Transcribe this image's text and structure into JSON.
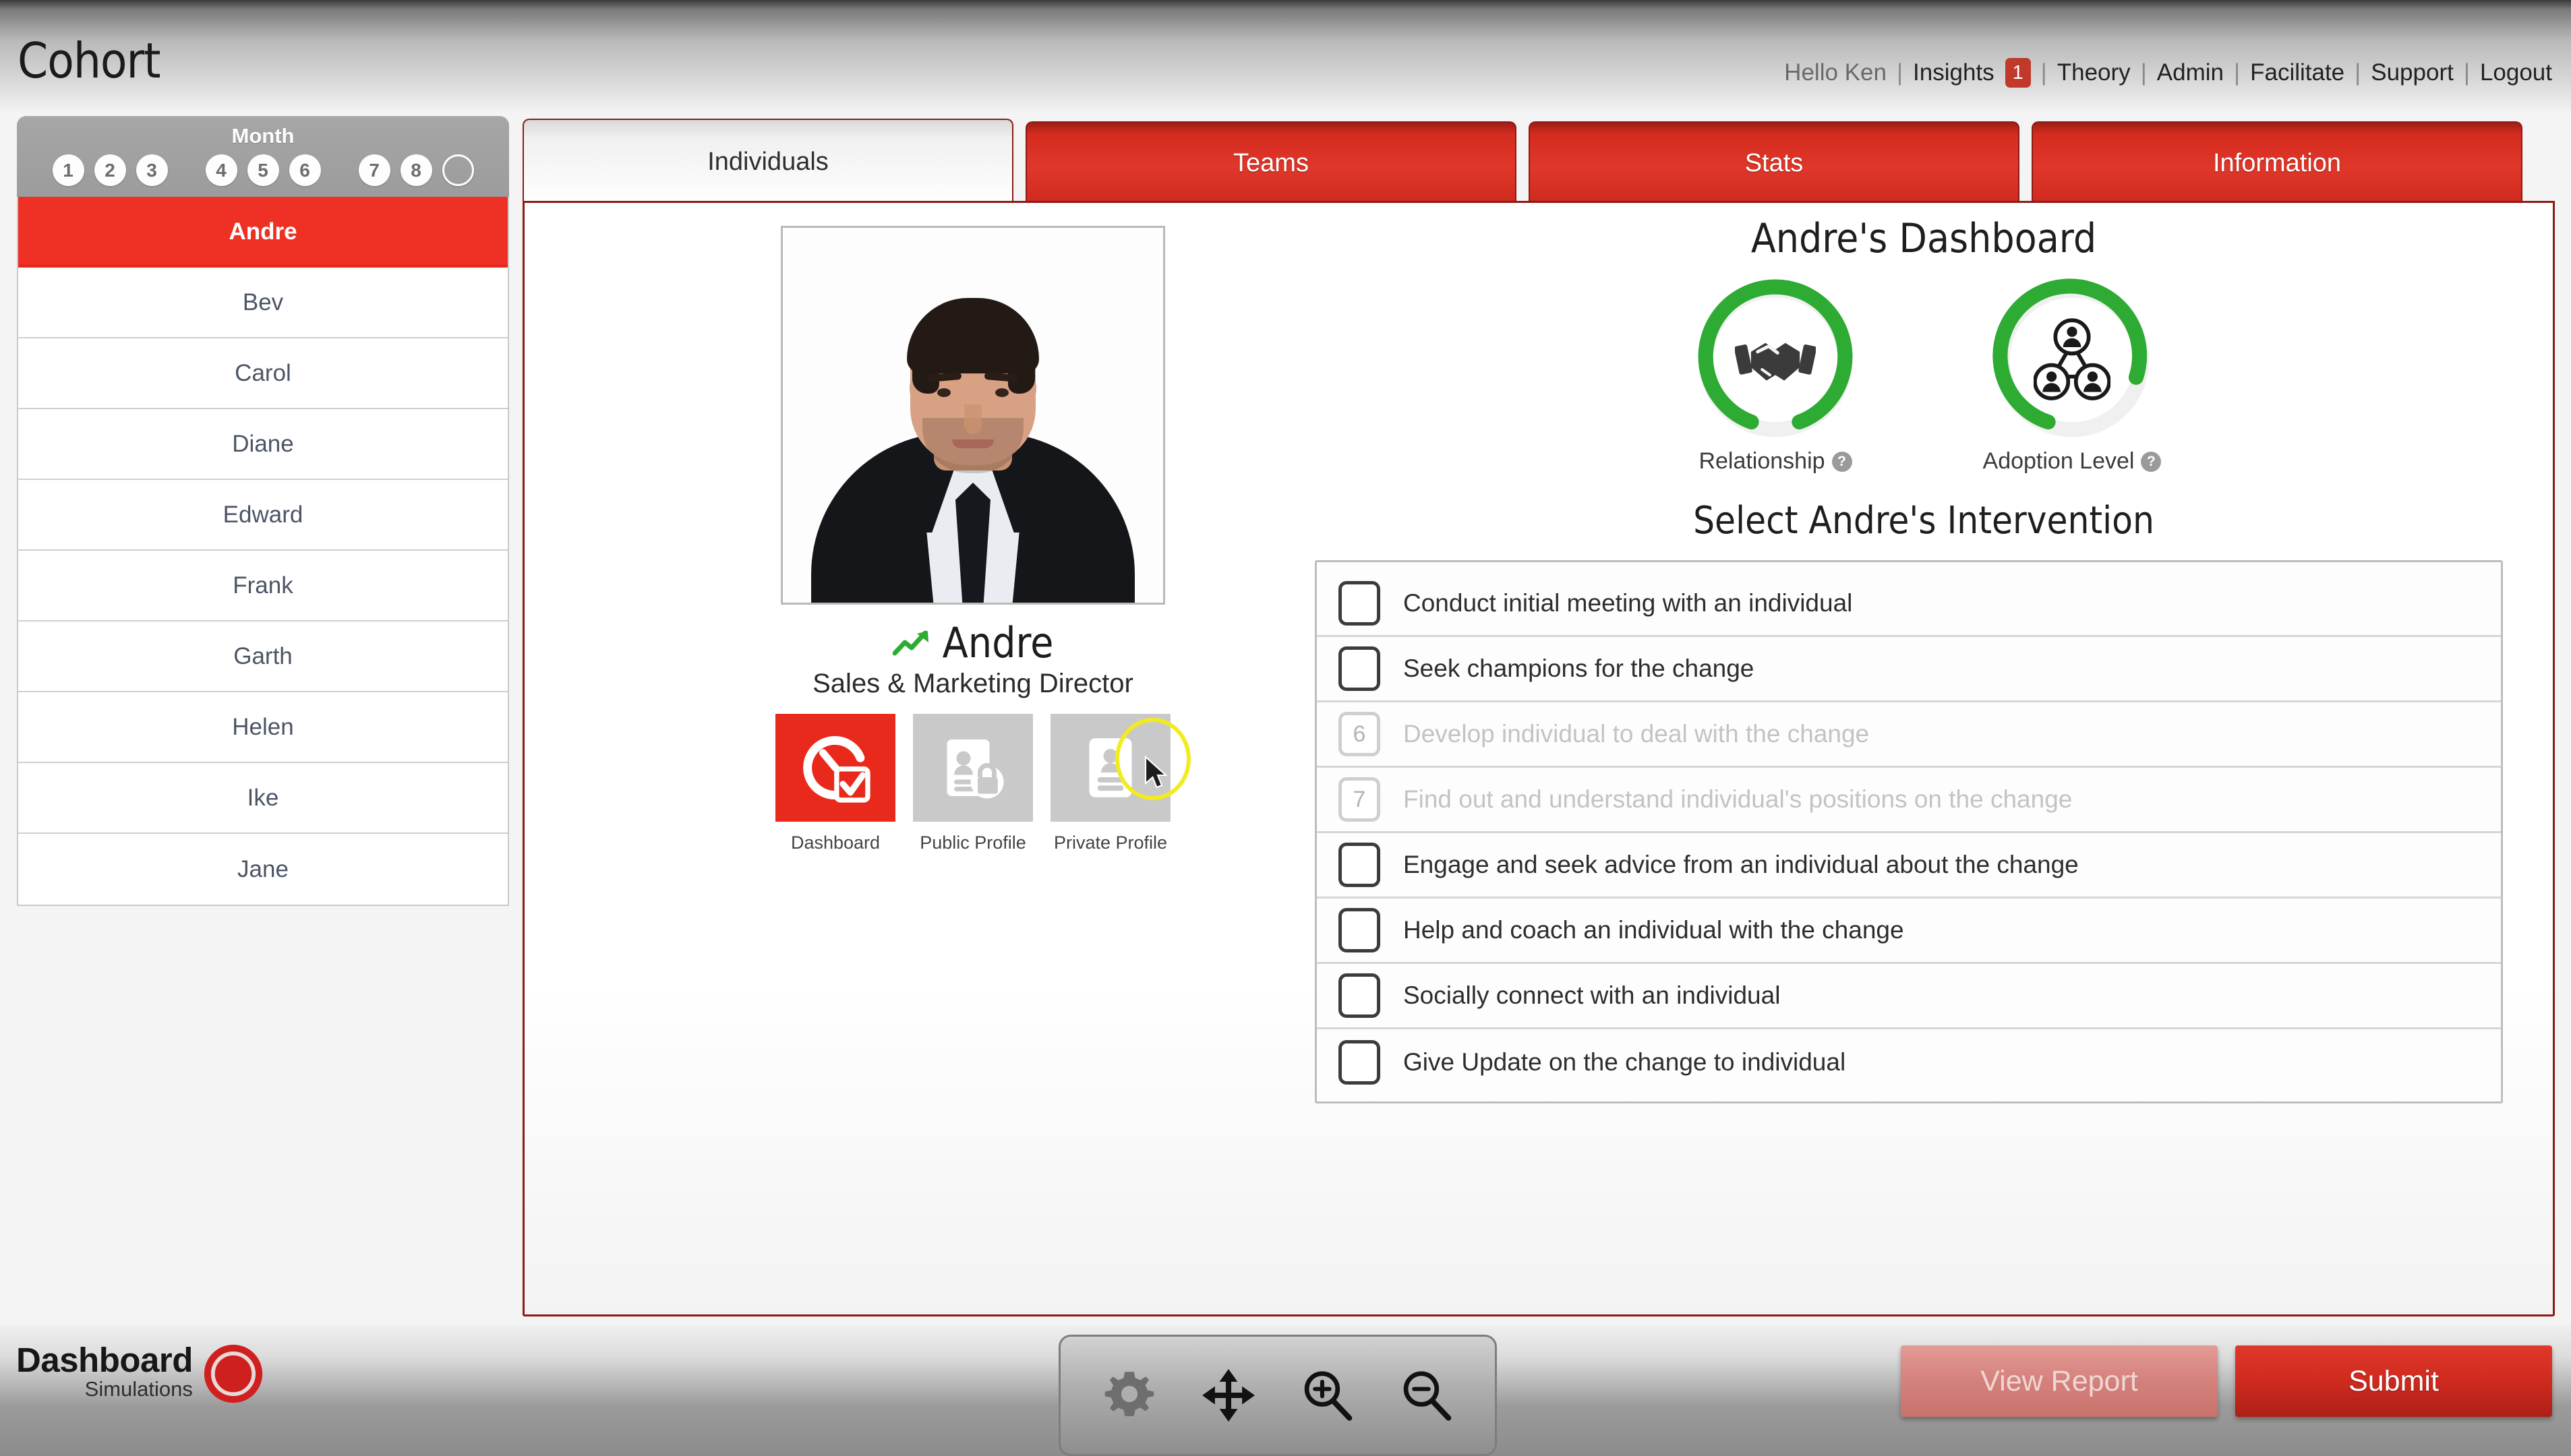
{
  "header": {
    "title": "Cohort",
    "greeting": "Hello Ken",
    "separator": "|",
    "nav": [
      {
        "label": "Insights",
        "badge": "1"
      },
      {
        "label": "Theory"
      },
      {
        "label": "Admin"
      },
      {
        "label": "Facilitate"
      },
      {
        "label": "Support"
      },
      {
        "label": "Logout"
      }
    ]
  },
  "sidebar": {
    "month_label": "Month",
    "months": [
      "1",
      "2",
      "3",
      "4",
      "5",
      "6",
      "7",
      "8",
      ""
    ],
    "people": [
      {
        "name": "Andre",
        "selected": true
      },
      {
        "name": "Bev",
        "selected": false
      },
      {
        "name": "Carol",
        "selected": false
      },
      {
        "name": "Diane",
        "selected": false
      },
      {
        "name": "Edward",
        "selected": false
      },
      {
        "name": "Frank",
        "selected": false
      },
      {
        "name": "Garth",
        "selected": false
      },
      {
        "name": "Helen",
        "selected": false
      },
      {
        "name": "Ike",
        "selected": false
      },
      {
        "name": "Jane",
        "selected": false
      }
    ]
  },
  "tabs": [
    {
      "label": "Individuals",
      "active": true
    },
    {
      "label": "Teams",
      "active": false
    },
    {
      "label": "Stats",
      "active": false
    },
    {
      "label": "Information",
      "active": false
    }
  ],
  "profile": {
    "name": "Andre",
    "role": "Sales & Marketing Director",
    "trend_icon": "trend-up-icon",
    "buttons": [
      {
        "caption": "Dashboard",
        "icon": "gauge-check-icon",
        "active": true
      },
      {
        "caption": "Public Profile",
        "icon": "id-card-lock-icon",
        "active": false
      },
      {
        "caption": "Private Profile",
        "icon": "id-card-icon",
        "active": false
      }
    ]
  },
  "dashboard": {
    "title": "Andre's Dashboard",
    "gauges": [
      {
        "label": "Relationship",
        "icon": "handshake-icon",
        "percent": 90,
        "color": "#2eab32",
        "help": "?"
      },
      {
        "label": "Adoption Level",
        "icon": "network-people-icon",
        "percent": 78,
        "color": "#2eab32",
        "help": "?"
      }
    ]
  },
  "interventions": {
    "title": "Select Andre's Intervention",
    "items": [
      {
        "label": "Conduct initial meeting with an individual",
        "checked": false,
        "disabled": false,
        "number": ""
      },
      {
        "label": "Seek champions for the change",
        "checked": false,
        "disabled": false,
        "number": ""
      },
      {
        "label": "Develop individual to deal with the change",
        "checked": false,
        "disabled": true,
        "number": "6"
      },
      {
        "label": "Find out and understand individual's positions on the change",
        "checked": false,
        "disabled": true,
        "number": "7"
      },
      {
        "label": "Engage and seek advice from an individual about the change",
        "checked": false,
        "disabled": false,
        "number": ""
      },
      {
        "label": "Help and coach an individual with the change",
        "checked": false,
        "disabled": false,
        "number": ""
      },
      {
        "label": "Socially connect with an individual",
        "checked": false,
        "disabled": false,
        "number": ""
      },
      {
        "label": "Give Update on the change to individual",
        "checked": false,
        "disabled": false,
        "number": ""
      }
    ]
  },
  "footer": {
    "logo_main": "Dashboard",
    "logo_sub": "Simulations",
    "tools": [
      {
        "name": "gear-icon"
      },
      {
        "name": "move-icon"
      },
      {
        "name": "zoom-in-icon"
      },
      {
        "name": "zoom-out-icon"
      }
    ],
    "view_report_label": "View Report",
    "submit_label": "Submit"
  },
  "colors": {
    "brand_red": "#ee3124",
    "tab_red": "#d42b1f",
    "border_red": "#8c1a15",
    "gauge_green": "#2eab32",
    "cursor_highlight": "#f2eb1e"
  }
}
